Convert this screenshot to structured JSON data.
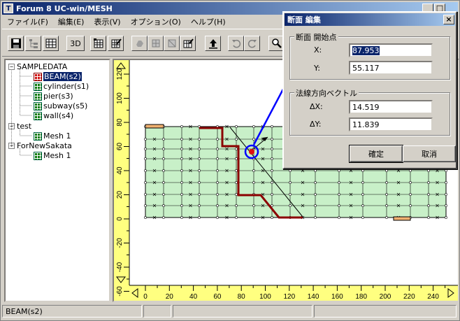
{
  "window": {
    "title": "Forum 8   UC-win/MESH"
  },
  "menu": [
    "ファイル(F)",
    "編集(E)",
    "表示(V)",
    "オプション(O)",
    "ヘルプ(H)"
  ],
  "toolbar": {
    "view3d_label": "3D"
  },
  "tree": {
    "groups": [
      {
        "label": "SAMPLEDATA",
        "expander": "−",
        "items": [
          {
            "label": "BEAM(s2)",
            "selected": true,
            "icon_color": "#d01010"
          },
          {
            "label": "cylinder(s1)"
          },
          {
            "label": "pier(s3)"
          },
          {
            "label": "subway(s5)"
          },
          {
            "label": "wall(s4)"
          }
        ]
      },
      {
        "label": "test",
        "expander": "−",
        "items": [
          {
            "label": "Mesh 1"
          }
        ]
      },
      {
        "label": "ForNewSakata",
        "expander": "−",
        "items": [
          {
            "label": "Mesh 1"
          }
        ]
      }
    ]
  },
  "ruler": {
    "x_ticks": [
      "0",
      "20",
      "40",
      "60",
      "80",
      "100",
      "120",
      "140",
      "160",
      "180",
      "200",
      "220",
      "240"
    ],
    "y_ticks": [
      "120",
      "100",
      "80",
      "60",
      "40",
      "20",
      "0",
      "-20",
      "-40",
      "-60"
    ]
  },
  "status": {
    "text": "BEAM(s2)"
  },
  "dialog": {
    "title": "断面 編集",
    "close_glyph": "×",
    "start_group": "断面 開始点",
    "x_label": "X:",
    "x_value": "87.953",
    "y_label": "Y:",
    "y_value": "55.117",
    "normal_group": "法線方向ベクトル",
    "dx_label": "ΔX:",
    "dx_value": "14.519",
    "dy_label": "ΔY:",
    "dy_value": "11.839",
    "ok_label": "確定",
    "cancel_label": "取消"
  },
  "colors": {
    "mesh_fill": "#c8f0c8",
    "section_line": "#8b0000",
    "annotation": "#0000ff",
    "ruler": "#ffff80"
  }
}
